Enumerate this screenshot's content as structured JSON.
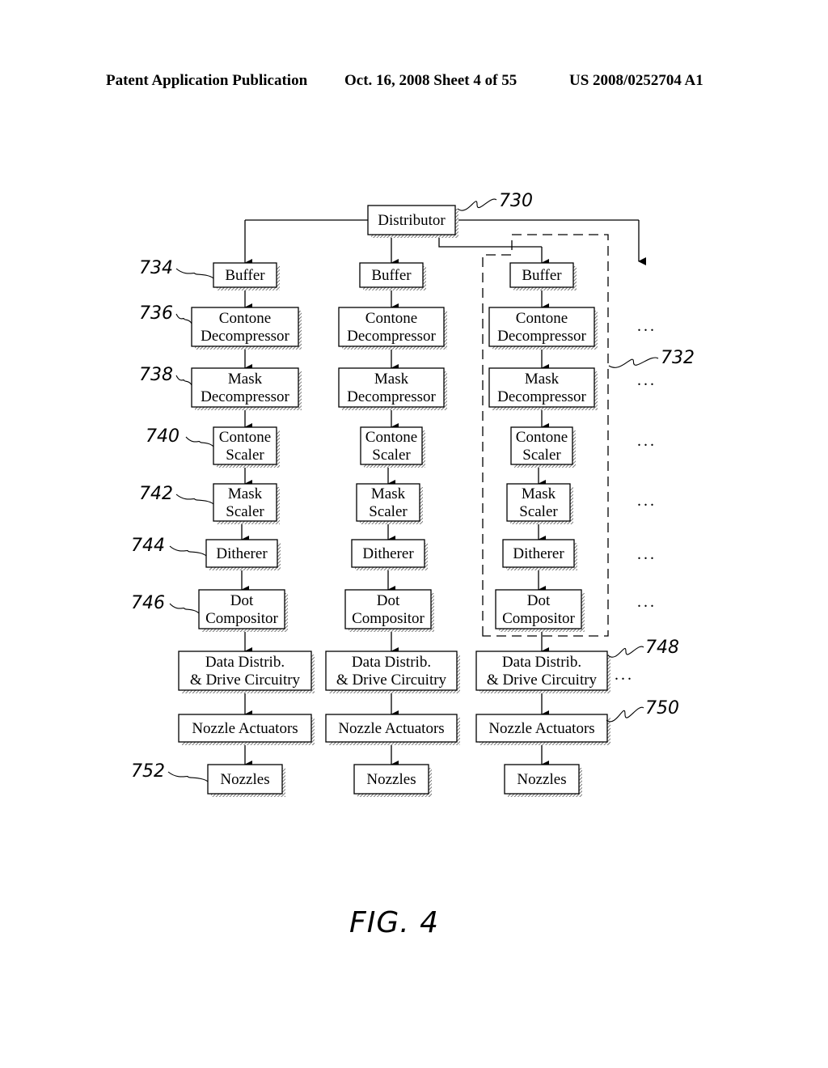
{
  "header": {
    "left": "Patent Application Publication",
    "middle": "Oct. 16, 2008   Sheet 4 of 55",
    "right": "US 2008/0252704 A1"
  },
  "figure_label": "FIG. 4",
  "distributor": {
    "label": "Distributor",
    "ref": "730"
  },
  "pipeline_ref_group": "732",
  "stage_labels": [
    [
      "Buffer"
    ],
    [
      "Contone",
      "Decompressor"
    ],
    [
      "Mask",
      "Decompressor"
    ],
    [
      "Contone",
      "Scaler"
    ],
    [
      "Mask",
      "Scaler"
    ],
    [
      "Ditherer"
    ],
    [
      "Dot",
      "Compositor"
    ],
    [
      "Data Distrib.",
      "& Drive Circuitry"
    ],
    [
      "Nozzle Actuators"
    ],
    [
      "Nozzles"
    ]
  ],
  "left_refs": [
    "734",
    "736",
    "738",
    "740",
    "742",
    "744",
    "746",
    null,
    null,
    "752"
  ],
  "right_refs": {
    "data_distrib": "748",
    "nozzle_actuators": "750"
  },
  "ellipsis": "...",
  "columns": 3
}
